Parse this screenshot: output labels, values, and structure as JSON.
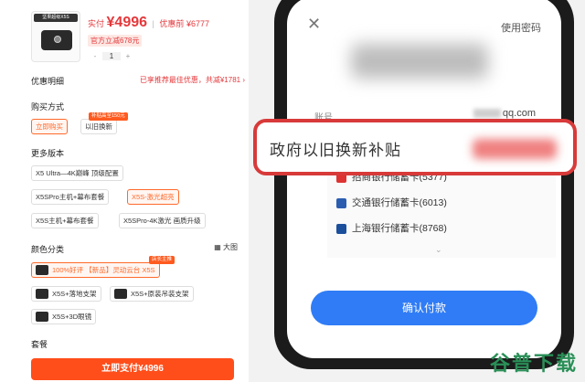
{
  "product": {
    "thumb_tag": "坚果超级X5S"
  },
  "price": {
    "actual_label": "实付",
    "actual_value": "¥4996",
    "sep": "|",
    "orig_label": "优惠前",
    "orig_value": "¥6777"
  },
  "subsidy_badge": "官方立减678元",
  "stepper": {
    "minus": "-",
    "qty": "1",
    "plus": "+"
  },
  "discount": {
    "title": "优惠明细",
    "right": "已享推荐最佳优惠，共减¥1781 ›"
  },
  "purchase": {
    "title": "购买方式",
    "opt1": "立即购买",
    "opt2": "以旧换新",
    "opt2_badge": "补贴高至150元"
  },
  "versions": {
    "title": "更多版本",
    "items": [
      "X5 Ultra—4K巅峰 顶级配置",
      "X5SPro主机+幕布套餐",
      "X5S-激光超亮",
      "X5S主机+幕布套餐",
      "X5SPro-4K激光 画质升级"
    ]
  },
  "colors": {
    "title": "颜色分类",
    "bigview": "大图",
    "items": [
      "100%好评 【新品】灵动云台 X5S",
      "X5S+落地支架",
      "X5S+原装吊装支架",
      "X5S+3D眼镜"
    ],
    "badge": "店长主推"
  },
  "package": {
    "title": "套餐"
  },
  "pay_button": "立即支付¥4996",
  "phone": {
    "close": "✕",
    "use_password": "使用密码",
    "account_label": "账号",
    "account_value": "qq.com",
    "callout_text": "政府以旧换新补贴",
    "banks": [
      "招商银行储蓄卡(5377)",
      "交通银行储蓄卡(6013)",
      "上海银行储蓄卡(8768)"
    ],
    "chevron": "⌄",
    "confirm": "确认付款"
  },
  "watermark": "谷普下载",
  "colors_theme": {
    "accent": "#ff4e1a",
    "link": "#2f7cf6",
    "alert": "#d83a3a"
  }
}
